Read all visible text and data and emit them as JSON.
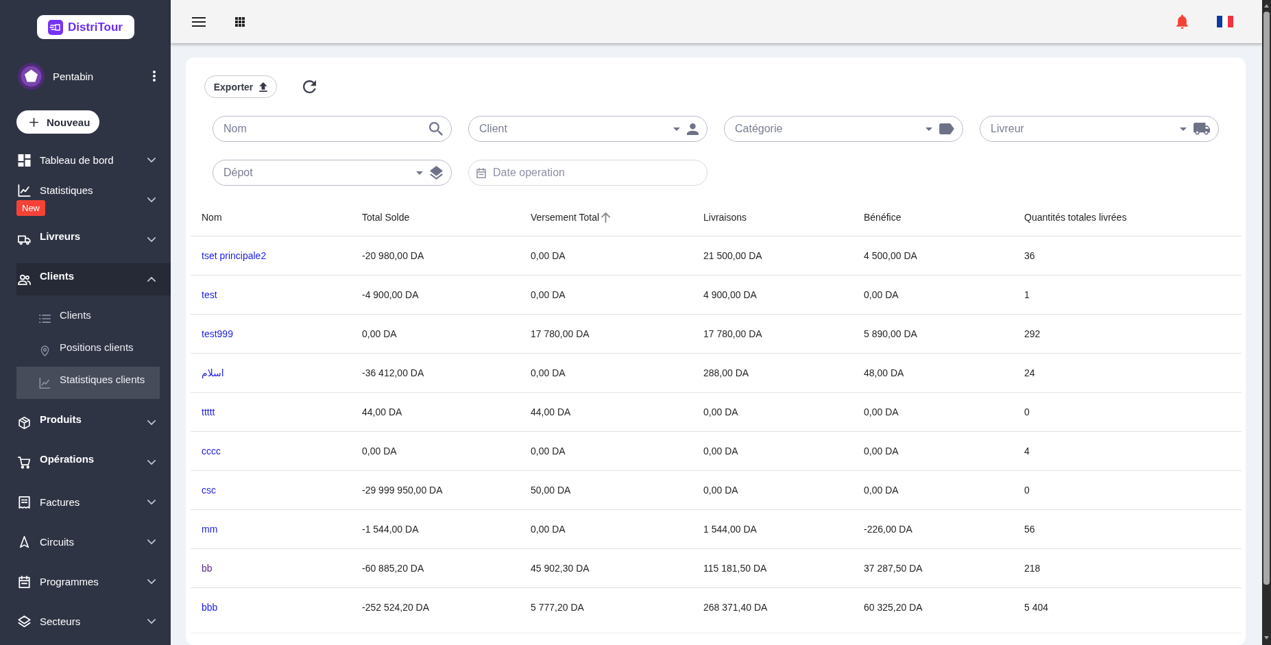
{
  "sidebar": {
    "brand": "DistriTour",
    "user": "Pentabin",
    "new_button": "Nouveau",
    "menu": [
      {
        "label": "Tableau de bord",
        "bold": false,
        "selected": false,
        "expanded": false
      },
      {
        "label": "Statistiques",
        "badge": "New",
        "bold": false,
        "selected": false,
        "expanded": false
      },
      {
        "label": "Livreurs",
        "bold": true,
        "selected": false,
        "expanded": false
      },
      {
        "label": "Clients",
        "bold": true,
        "selected": true,
        "expanded": true,
        "children": [
          {
            "label": "Clients",
            "selected": false
          },
          {
            "label": "Positions clients",
            "selected": false
          },
          {
            "label": "Statistiques clients",
            "selected": true
          }
        ]
      },
      {
        "label": "Produits",
        "bold": true,
        "selected": false,
        "expanded": false
      },
      {
        "label": "Opérations",
        "bold": true,
        "selected": false,
        "expanded": false
      },
      {
        "label": "Factures",
        "bold": false,
        "selected": false,
        "expanded": false
      },
      {
        "label": "Circuits",
        "bold": false,
        "selected": false,
        "expanded": false
      },
      {
        "label": "Programmes",
        "bold": false,
        "selected": false,
        "expanded": false
      },
      {
        "label": "Secteurs",
        "bold": false,
        "selected": false,
        "expanded": false
      }
    ]
  },
  "toolbar": {
    "export_button": "Exporter"
  },
  "filters": [
    {
      "kind": "search",
      "placeholder": "Nom"
    },
    {
      "kind": "select",
      "placeholder": "Client"
    },
    {
      "kind": "select",
      "placeholder": "Catégorie"
    },
    {
      "kind": "select",
      "placeholder": "Livreur"
    },
    {
      "kind": "select",
      "placeholder": "Dépot"
    },
    {
      "kind": "date",
      "placeholder": "Date operation"
    }
  ],
  "table": {
    "columns": [
      {
        "label": "Nom",
        "sorted": false
      },
      {
        "label": "Total Solde",
        "sorted": false
      },
      {
        "label": "Versement Total",
        "sorted": true
      },
      {
        "label": "Livraisons",
        "sorted": false
      },
      {
        "label": "Bénéfice",
        "sorted": false
      },
      {
        "label": "Quantités totales livrées",
        "sorted": false
      }
    ],
    "rows": [
      {
        "visited": false,
        "cells": [
          "tset principale2",
          "-20 980,00 DA",
          "0,00 DA",
          "21 500,00 DA",
          "4 500,00 DA",
          "36"
        ]
      },
      {
        "visited": false,
        "cells": [
          "test",
          "-4 900,00 DA",
          "0,00 DA",
          "4 900,00 DA",
          "0,00 DA",
          "1"
        ]
      },
      {
        "visited": false,
        "cells": [
          "test999",
          "0,00 DA",
          "17 780,00 DA",
          "17 780,00 DA",
          "5 890,00 DA",
          "292"
        ]
      },
      {
        "visited": false,
        "cells": [
          "اسلام",
          "-36 412,00 DA",
          "0,00 DA",
          "288,00 DA",
          "48,00 DA",
          "24"
        ]
      },
      {
        "visited": false,
        "cells": [
          "ttttt",
          "44,00 DA",
          "44,00 DA",
          "0,00 DA",
          "0,00 DA",
          "0"
        ]
      },
      {
        "visited": false,
        "cells": [
          "cccc",
          "0,00 DA",
          "0,00 DA",
          "0,00 DA",
          "0,00 DA",
          "4"
        ]
      },
      {
        "visited": false,
        "cells": [
          "csc",
          "-29 999 950,00 DA",
          "50,00 DA",
          "0,00 DA",
          "0,00 DA",
          "0"
        ]
      },
      {
        "visited": false,
        "cells": [
          "mm",
          "-1 544,00 DA",
          "0,00 DA",
          "1 544,00 DA",
          "-226,00 DA",
          "56"
        ]
      },
      {
        "visited": true,
        "cells": [
          "bb",
          "-60 885,20 DA",
          "45 902,30 DA",
          "115 181,50 DA",
          "37 287,50 DA",
          "218"
        ]
      },
      {
        "visited": false,
        "cells": [
          "bbb",
          "-252 524,20 DA",
          "5 777,20 DA",
          "268 371,40 DA",
          "60 325,20 DA",
          "5 404"
        ]
      }
    ]
  }
}
